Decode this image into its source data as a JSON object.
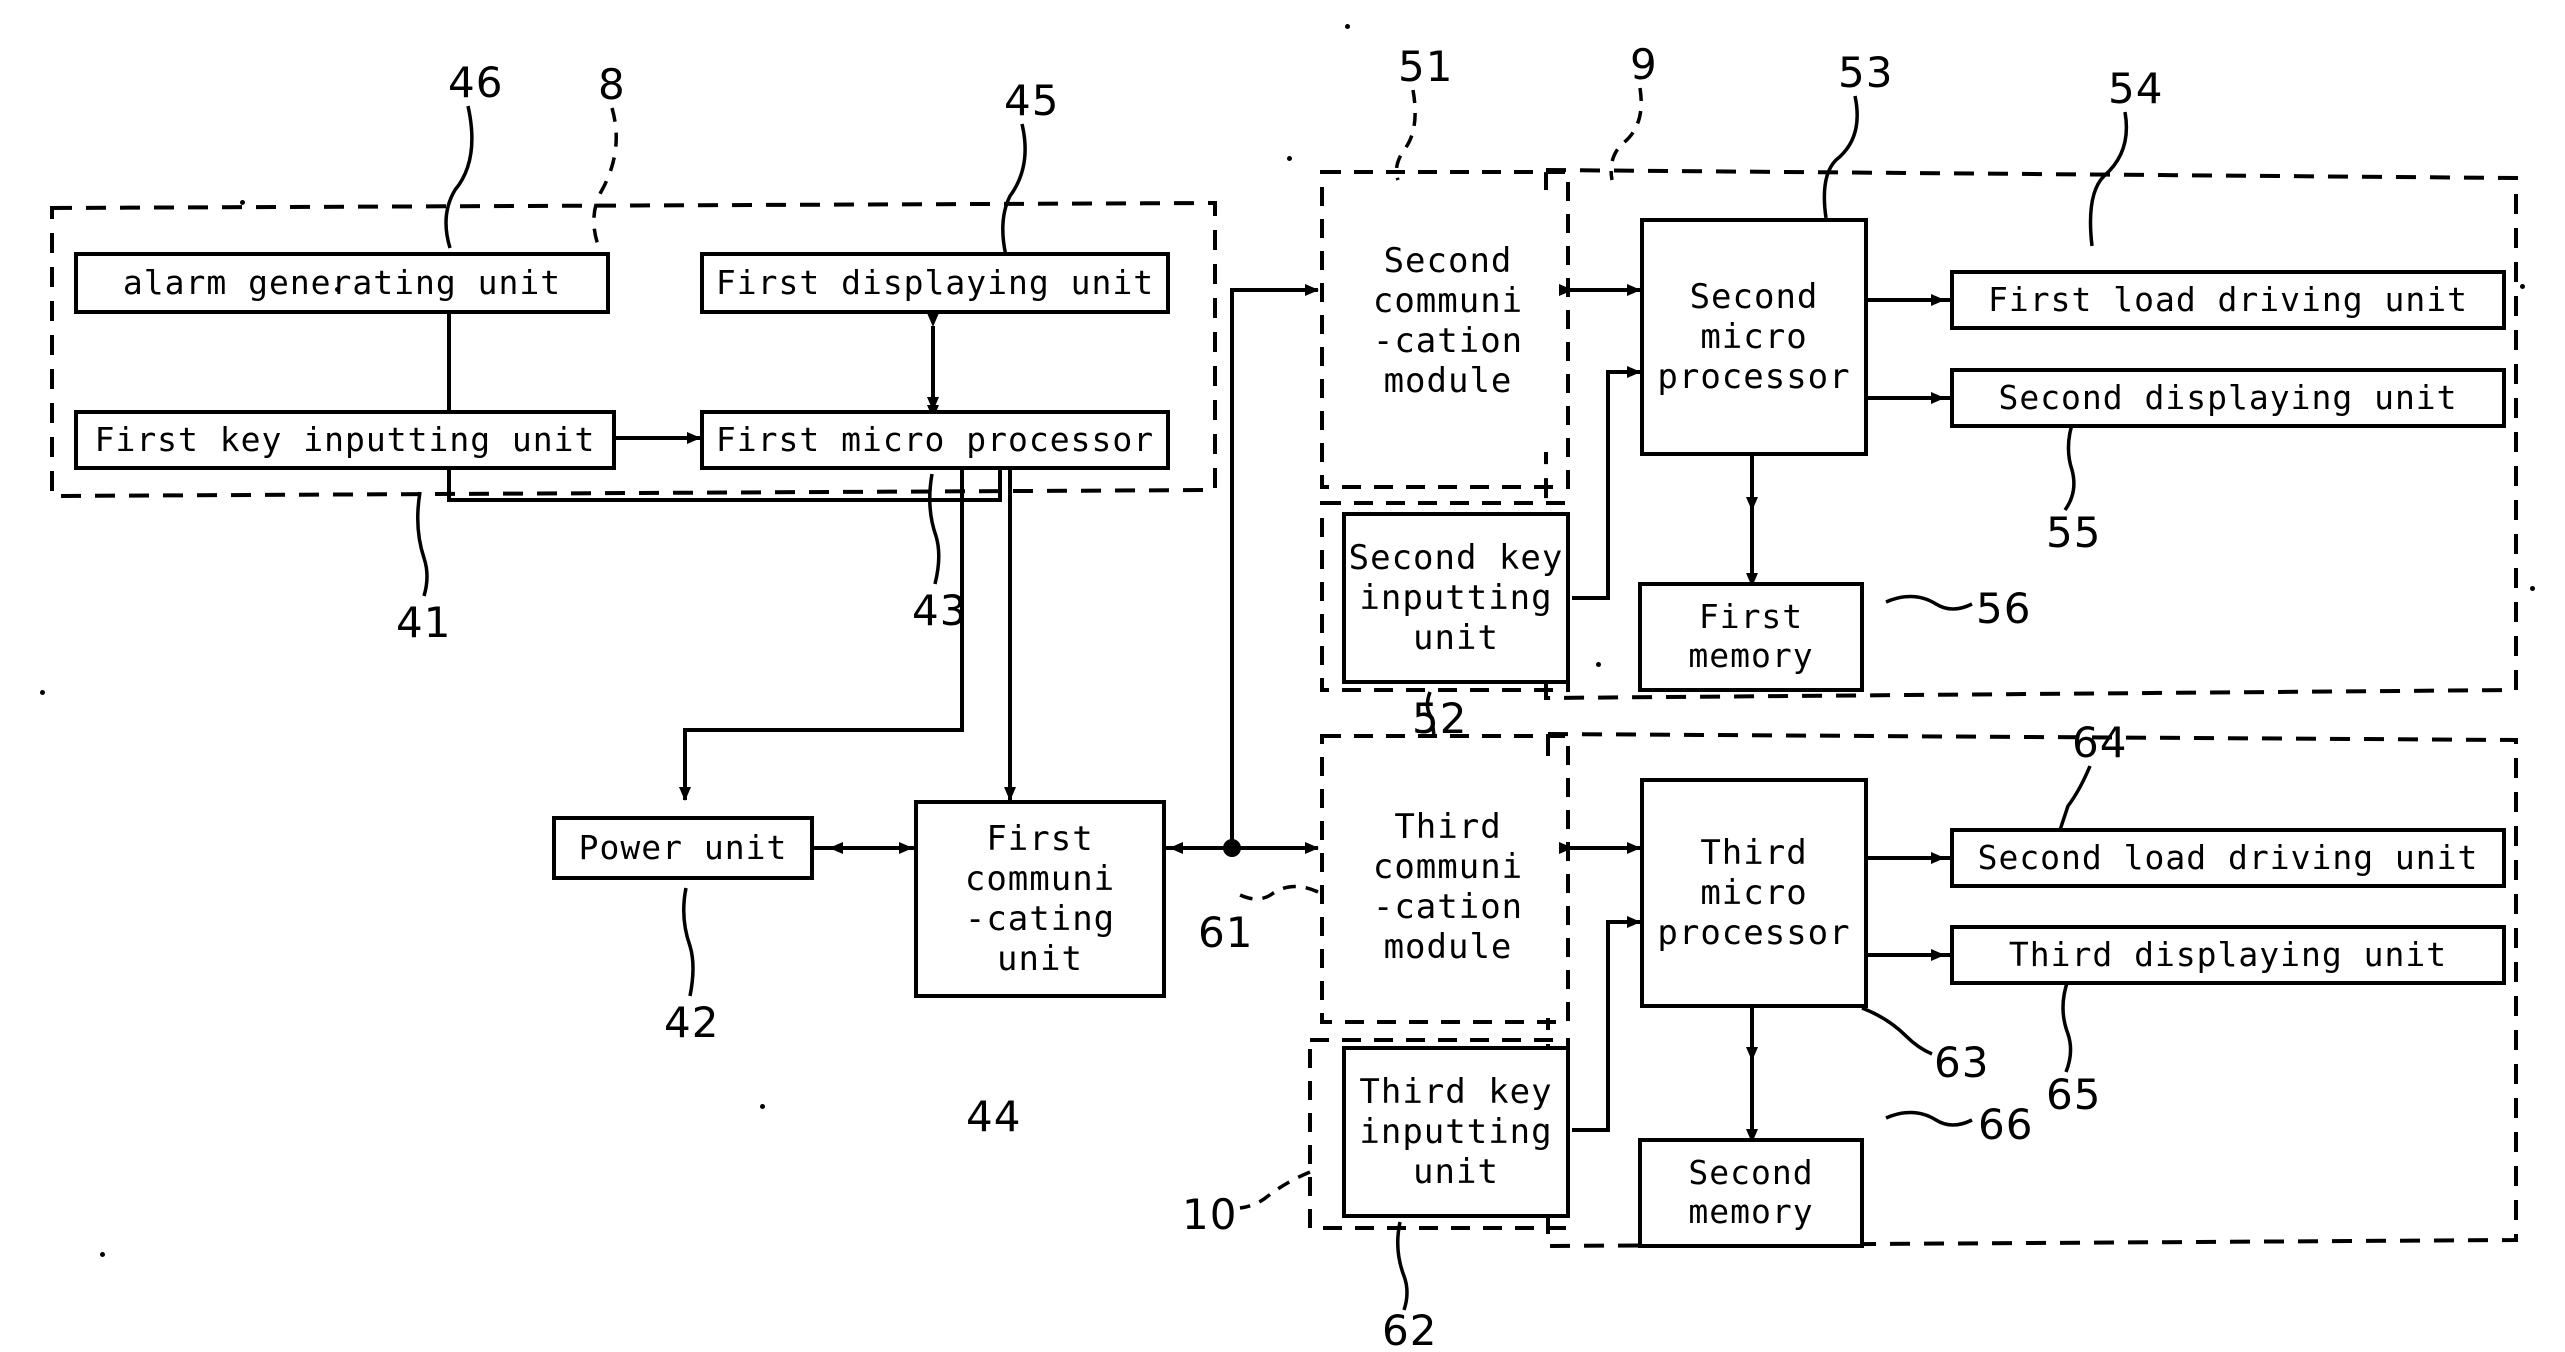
{
  "figure": {
    "type": "patent-block-diagram",
    "description": "Block diagram of a control system with first, second and third communication units"
  },
  "groups": [
    {
      "id": "group-8",
      "label": "8"
    },
    {
      "id": "group-51",
      "label": "51"
    },
    {
      "id": "group-9",
      "label": "9"
    },
    {
      "id": "group-61",
      "label": "61"
    },
    {
      "id": "group-10",
      "label": "10"
    }
  ],
  "blocks": {
    "alarm_generating_unit": "alarm generating unit",
    "first_displaying_unit": "First displaying unit",
    "first_key_inputting_unit": "First key inputting unit",
    "first_micro_processor": "First micro processor",
    "power_unit": "Power unit",
    "first_communicating_unit": "First\ncommuni\n-cating\nunit",
    "second_communication_module": "Second\ncommuni\n-cation\nmodule",
    "second_micro_processor": "Second\nmicro\nprocessor",
    "first_load_driving_unit": "First load driving unit",
    "second_displaying_unit": "Second displaying unit",
    "second_key_inputting_unit": "Second key\ninputting\nunit",
    "first_memory": "First\nmemory",
    "third_communication_module": "Third\ncommuni\n-cation\nmodule",
    "third_micro_processor": "Third\nmicro\nprocessor",
    "second_load_driving_unit": "Second load driving unit",
    "third_displaying_unit": "Third displaying unit",
    "third_key_inputting_unit": "Third key\ninputting\nunit",
    "second_memory": "Second\nmemory"
  },
  "reference_numerals": {
    "n46": "46",
    "n8": "8",
    "n45": "45",
    "n51": "51",
    "n9": "9",
    "n53": "53",
    "n54": "54",
    "n55": "55",
    "n41": "41",
    "n43": "43",
    "n52": "52",
    "n56": "56",
    "n42": "42",
    "n44": "44",
    "n61": "61",
    "n64": "64",
    "n65": "65",
    "n63": "63",
    "n66": "66",
    "n10": "10",
    "n62": "62"
  },
  "colors": {
    "line": "#000000",
    "background": "#ffffff"
  }
}
